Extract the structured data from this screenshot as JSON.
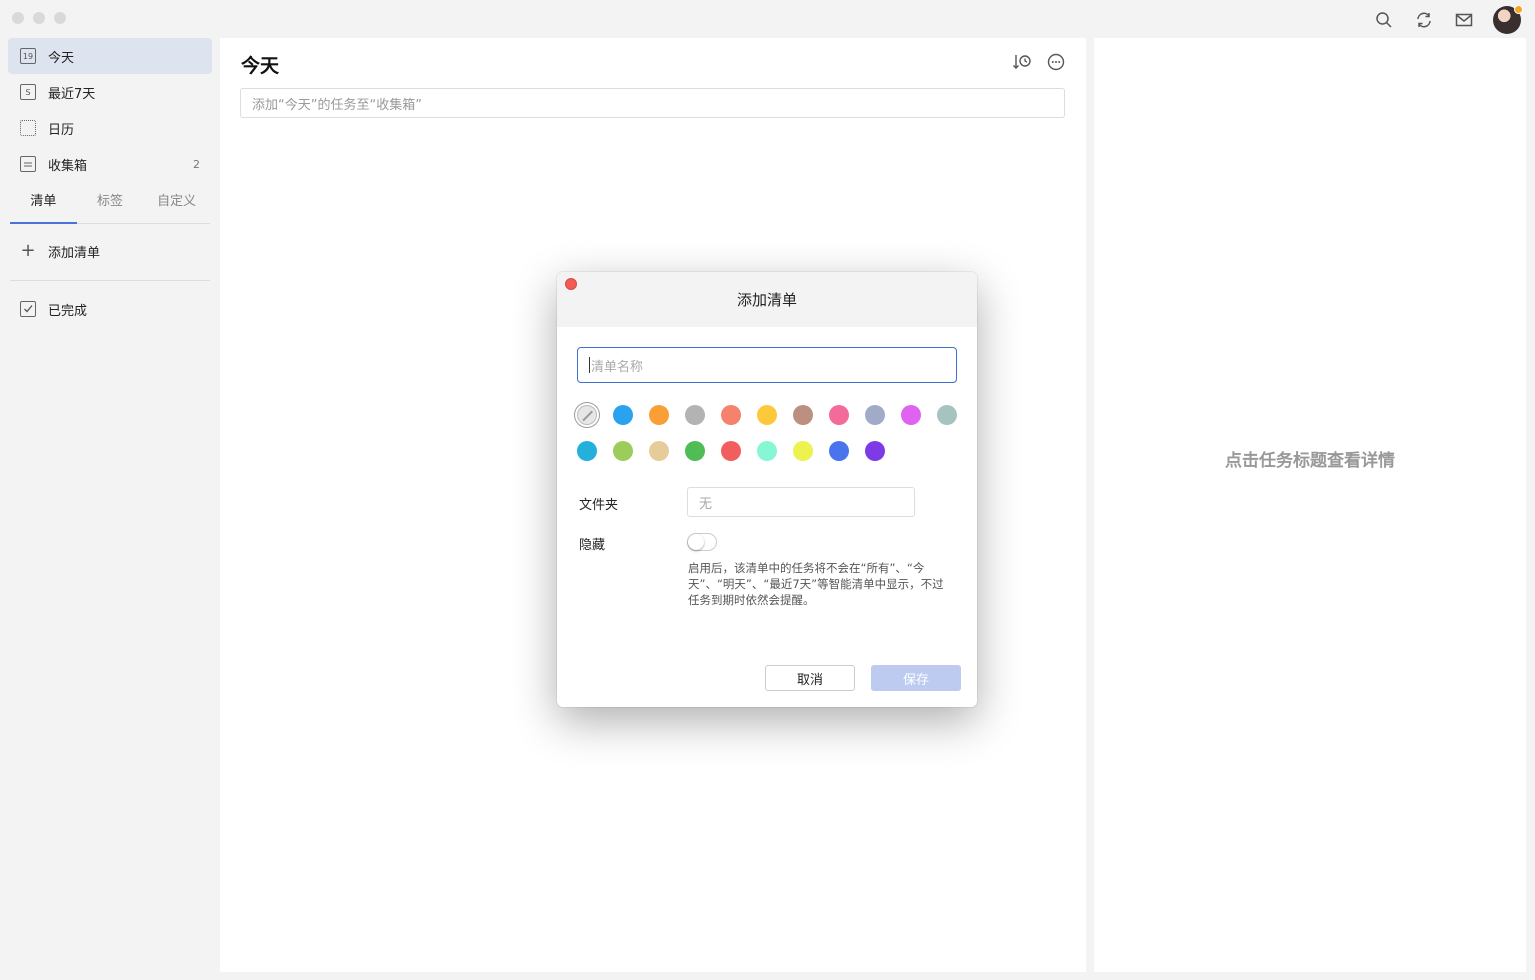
{
  "titlebar": {
    "icons": [
      "search-icon",
      "sync-icon",
      "mail-icon"
    ]
  },
  "sidebar": {
    "items": [
      {
        "label": "今天",
        "icon_text": "19",
        "active": true
      },
      {
        "label": "最近7天",
        "icon_text": "S"
      },
      {
        "label": "日历",
        "icon_text": ""
      },
      {
        "label": "收集箱",
        "icon_text": "",
        "count": "2"
      }
    ],
    "tabs": [
      "清单",
      "标签",
      "自定义"
    ],
    "add_list": "添加清单",
    "completed": "已完成"
  },
  "main": {
    "title": "今天",
    "quick_add_placeholder": "添加“今天”的任务至“收集箱”"
  },
  "detail": {
    "hint": "点击任务标题查看详情"
  },
  "dialog": {
    "title": "添加清单",
    "name_placeholder": "清单名称",
    "colors_row1": [
      "none",
      "#29a3ef",
      "#f99f35",
      "#b3b3b3",
      "#f5826c",
      "#fdc93a",
      "#bc9080",
      "#f36b9b",
      "#a1abc9",
      "#df62f0",
      "#a6c3c0"
    ],
    "colors_row2": [
      "#23b0da",
      "#9ccd5a",
      "#e5cc9a",
      "#4fbc55",
      "#f25e5e",
      "#86f6d4",
      "#ecf24e",
      "#4a73ee",
      "#7f3ae8"
    ],
    "folder_label": "文件夹",
    "folder_placeholder": "无",
    "hide_label": "隐藏",
    "hide_enabled": false,
    "hide_desc": "启用后，该清单中的任务将不会在“所有”、“今天”、“明天”、“最近7天”等智能清单中显示，不过任务到期时依然会提醒。",
    "cancel": "取消",
    "save": "保存"
  }
}
